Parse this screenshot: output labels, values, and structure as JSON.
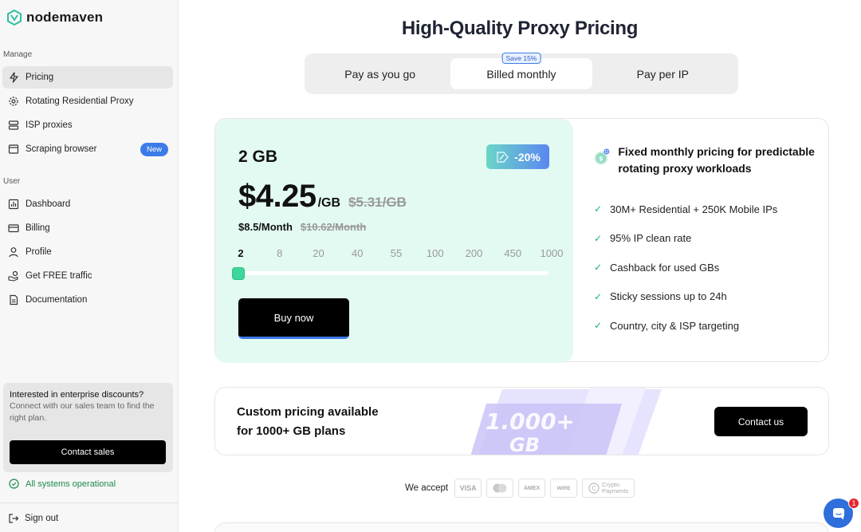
{
  "brand": {
    "name": "nodemaven"
  },
  "sidebar": {
    "manage_label": "Manage",
    "manage_items": [
      {
        "label": "Pricing",
        "icon": "bolt-icon",
        "active": true
      },
      {
        "label": "Rotating Residential Proxy",
        "icon": "gear-icon"
      },
      {
        "label": "ISP proxies",
        "icon": "server-icon"
      },
      {
        "label": "Scraping browser",
        "icon": "browser-icon",
        "badge": "New"
      }
    ],
    "user_label": "User",
    "user_items": [
      {
        "label": "Dashboard",
        "icon": "bar-chart-icon"
      },
      {
        "label": "Billing",
        "icon": "credit-card-icon"
      },
      {
        "label": "Profile",
        "icon": "user-icon"
      },
      {
        "label": "Get FREE traffic",
        "icon": "hand-coin-icon"
      },
      {
        "label": "Documentation",
        "icon": "document-icon"
      }
    ],
    "enterprise": {
      "title": "Interested in enterprise discounts?",
      "description": "Connect with our sales team to find the right plan.",
      "button": "Contact sales"
    },
    "status": "All systems operational",
    "sign_out": "Sign out"
  },
  "main": {
    "title": "High-Quality Proxy Pricing",
    "tabs": [
      {
        "label": "Pay as you go"
      },
      {
        "label": "Billed monthly",
        "badge": "Save 15%",
        "active": true
      },
      {
        "label": "Pay per IP"
      }
    ],
    "plan": {
      "gb": "2 GB",
      "discount": "-20%",
      "price": "$4.25",
      "price_unit": "/GB",
      "price_old": "$5.31/GB",
      "monthly": "$8.5/Month",
      "monthly_old": "$10.62/Month",
      "gb_options": [
        "2",
        "8",
        "20",
        "40",
        "55",
        "100",
        "200",
        "450",
        "1000"
      ],
      "selected_gb_index": 0,
      "buy_button": "Buy now"
    },
    "features": {
      "headline": "Fixed monthly pricing for predictable rotating proxy workloads",
      "items": [
        "30M+ Residential + 250K Mobile IPs",
        "95% IP clean rate",
        "Cashback for used GBs",
        "Sticky sessions up to 24h",
        "Country, city & ISP targeting"
      ]
    },
    "custom": {
      "line1": "Custom pricing available",
      "line2": "for 1000+ GB plans",
      "art_line1": "1.000+",
      "art_line2": "GB",
      "button": "Contact us"
    },
    "payments": {
      "label": "We accept",
      "methods": [
        "VISA",
        "AMEX",
        "WIRE",
        "Crypto",
        "Payments"
      ]
    },
    "chat": {
      "unread": "1"
    }
  },
  "colors": {
    "accent_green": "#3ed69a",
    "accent_blue": "#3d7be8",
    "plan_bg": "#e3faf2",
    "status_green": "#1e8a4c"
  }
}
